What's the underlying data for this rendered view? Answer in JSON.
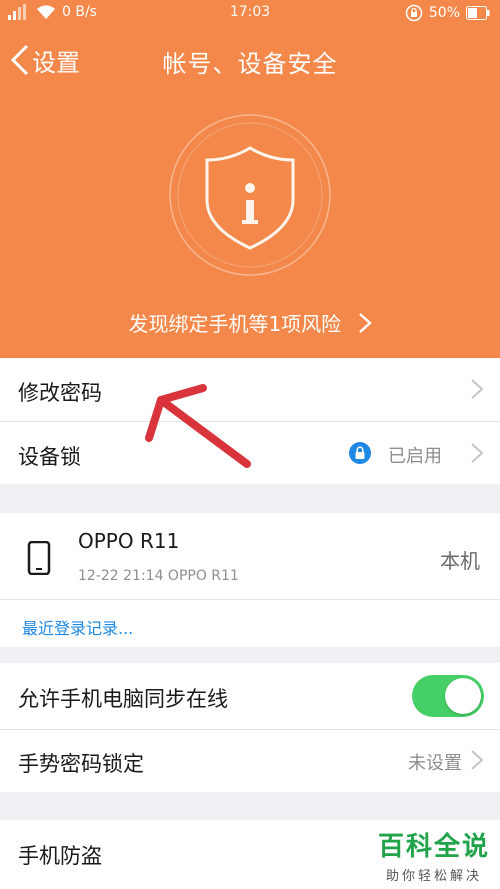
{
  "status_bar": {
    "network_speed": "0 B/s",
    "time": "17:03",
    "battery": "50%"
  },
  "header": {
    "back_label": "设置",
    "title": "帐号、设备安全",
    "risk_text": "发现绑定手机等1项风险",
    "colors": {
      "header_bg": "#f4884a",
      "accent_blue": "#1e88e5",
      "toggle_on": "#45cf66"
    }
  },
  "menu": {
    "change_password": "修改密码",
    "device_lock": {
      "label": "设备锁",
      "status": "已启用"
    }
  },
  "device": {
    "name": "OPPO R11",
    "last_login": "12-22 21:14 OPPO R11",
    "tag": "本机",
    "recent_login_link": "最近登录记录..."
  },
  "settings": {
    "sync_online": {
      "label": "允许手机电脑同步在线",
      "enabled": true
    },
    "gesture_lock": {
      "label": "手势密码锁定",
      "value": "未设置"
    },
    "anti_theft": {
      "label": "手机防盗"
    }
  },
  "watermark": {
    "main": "百科全说",
    "sub": "助你轻松解决"
  },
  "icons": [
    "signal-icon",
    "wifi-icon",
    "rotation-lock-icon",
    "battery-icon",
    "back-chevron-icon",
    "shield-info-icon",
    "chevron-right-icon",
    "lock-icon",
    "phone-icon",
    "annotation-arrow"
  ]
}
